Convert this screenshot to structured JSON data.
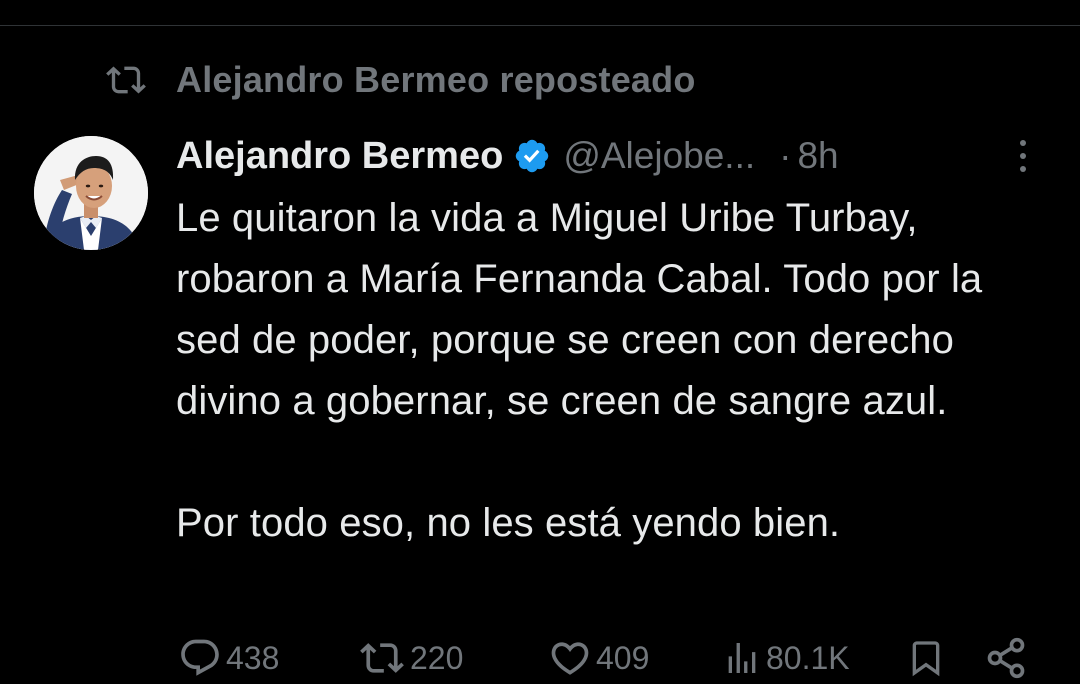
{
  "repost": {
    "label": "Alejandro Bermeo reposteado",
    "icon": "repost-icon"
  },
  "tweet": {
    "author": {
      "display_name": "Alejandro Bermeo",
      "handle": "@Alejobe...",
      "verified": true,
      "avatar": "profile-photo-saluting-man"
    },
    "separator": "·",
    "time": "8h",
    "paragraphs": [
      "Le quitaron la vida a Miguel Uribe Turbay, robaron a María Fernanda Cabal. Todo por la sed de poder, porque se creen con derecho divino a gobernar, se creen de sangre azul.",
      "Por todo eso, no les está yendo bien."
    ]
  },
  "actions": {
    "replies": "438",
    "reposts": "220",
    "likes": "409",
    "views": "80.1K"
  },
  "colors": {
    "background": "#000000",
    "text": "#e7e9ea",
    "muted": "#71767b",
    "verified": "#1d9bf0"
  }
}
